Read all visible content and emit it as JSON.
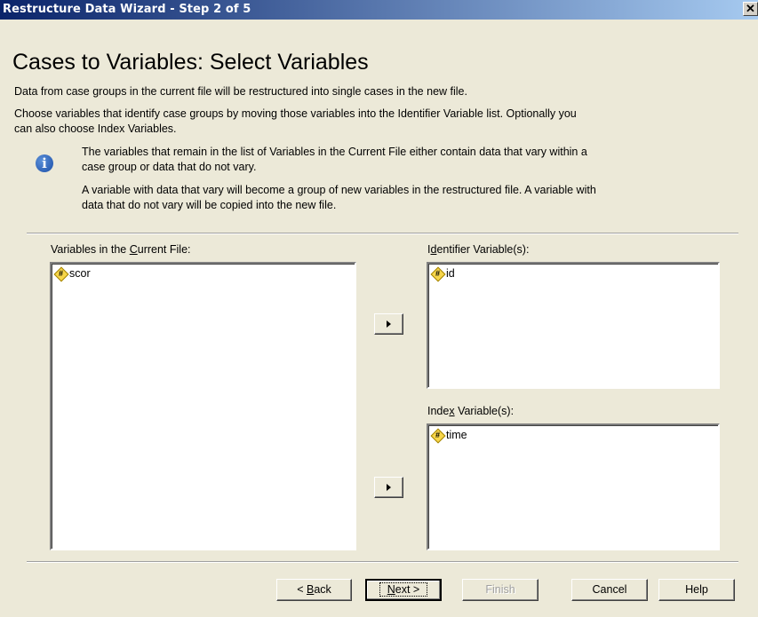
{
  "window": {
    "title": "Restructure Data Wizard - Step 2 of 5",
    "close_glyph": "✕"
  },
  "page": {
    "heading": "Cases to Variables: Select Variables",
    "paragraph1": "Data from case groups in the current file will be restructured into single cases in the new file.",
    "paragraph2_line1": "Choose variables that identify case groups by moving those variables into the Identifier Variable list.  Optionally you",
    "paragraph2_line2": "can also choose Index Variables.",
    "info_glyph": "i",
    "info1_line1": "The variables that remain in the list of Variables in the Current File either contain data that vary within a",
    "info1_line2": "case group or data that do not vary.",
    "info2_line1": "A variable with data that vary will become a group of new variables in the restructured file.  A variable with",
    "info2_line2": "data that do not vary will be copied into the new file."
  },
  "lists": {
    "current": {
      "label_pre": "Variables in the ",
      "label_u": "C",
      "label_post": "urrent File:",
      "items": [
        "scor"
      ]
    },
    "identifier": {
      "label_pre": "I",
      "label_u": "d",
      "label_post": "entifier Variable(s):",
      "items": [
        "id"
      ]
    },
    "index": {
      "label_pre": "Inde",
      "label_u": "x",
      "label_post": " Variable(s):",
      "items": [
        "time"
      ]
    }
  },
  "icons": {
    "variable": "scale-variable-icon",
    "variable_glyph": "#"
  },
  "buttons": {
    "back_pre": "< ",
    "back_u": "B",
    "back_post": "ack",
    "next_u": "N",
    "next_post": "ext >",
    "finish": "Finish",
    "cancel": "Cancel",
    "help": "Help"
  }
}
